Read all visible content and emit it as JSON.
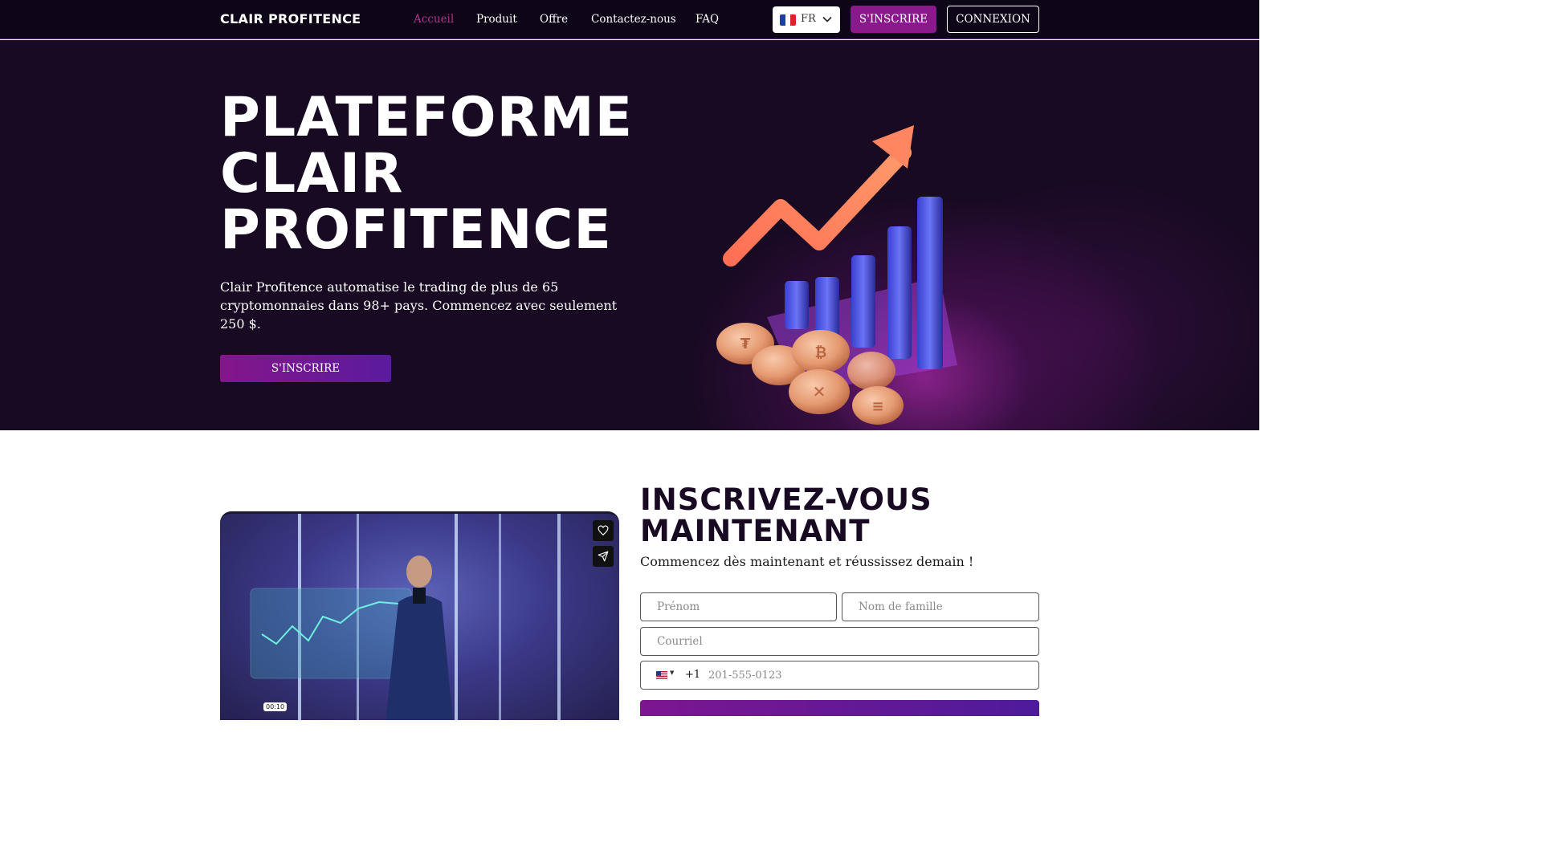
{
  "nav": {
    "logo": "CLAIR PROFITENCE",
    "links": [
      {
        "label": "Accueil",
        "active": true
      },
      {
        "label": "Produit",
        "active": false
      },
      {
        "label": "Offre",
        "active": false
      },
      {
        "label": "Contactez-nous",
        "active": false
      },
      {
        "label": "FAQ",
        "active": false
      }
    ],
    "language": {
      "code": "FR",
      "flag": "flag-fr-icon"
    },
    "signup_label": "S'INSCRIRE",
    "login_label": "CONNEXION"
  },
  "hero": {
    "title_lines": [
      "PLATEFORME",
      "CLAIR",
      "PROFITENCE"
    ],
    "description": "Clair Profitence automatise le trading de plus de 65 cryptomonnaies dans 98+ pays. Commencez avec seulement 250 $.",
    "cta_label": "S'INSCRIRE",
    "illustration": "growth-chart-with-crypto-coins-icon"
  },
  "signup": {
    "title_lines": [
      "INSCRIVEZ-VOUS",
      "MAINTENANT"
    ],
    "subtitle": "Commencez dès maintenant et réussissez demain !",
    "first_name_placeholder": "Prénom",
    "last_name_placeholder": "Nom de famille",
    "email_placeholder": "Courriel",
    "phone": {
      "country_flag": "flag-us-icon",
      "dial_code": "+1",
      "placeholder": "201-555-0123"
    }
  },
  "video": {
    "time": "00:10",
    "like_icon": "heart-icon",
    "share_icon": "send-icon"
  },
  "colors": {
    "hero_bg": "#170a22",
    "accent": "#8a1a8c",
    "active_link": "#b0348f"
  }
}
